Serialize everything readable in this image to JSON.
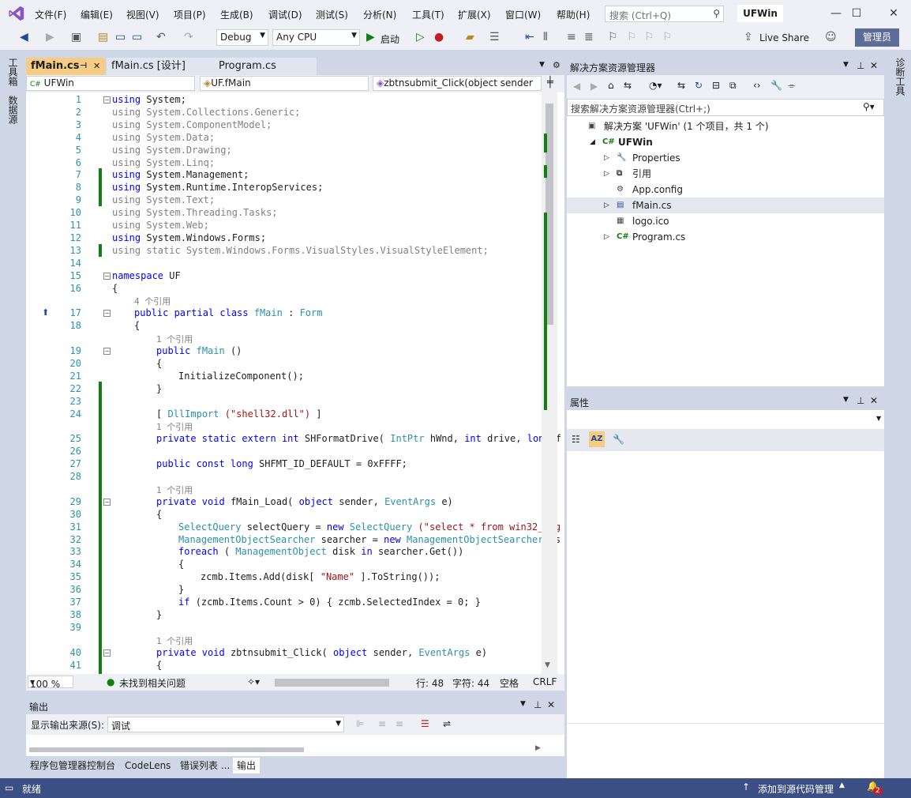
{
  "app": {
    "title": "UFWin",
    "window_controls": [
      "minimize-icon",
      "maximize-icon",
      "close-icon"
    ]
  },
  "menu": {
    "items": [
      "文件(F)",
      "编辑(E)",
      "视图(V)",
      "项目(P)",
      "生成(B)",
      "调试(D)",
      "测试(S)",
      "分析(N)",
      "工具(T)",
      "扩展(X)",
      "窗口(W)",
      "帮助(H)"
    ],
    "search_placeholder": "搜索 (Ctrl+Q)",
    "solution_name": "UFWin"
  },
  "toolbar": {
    "config": "Debug",
    "platform": "Any CPU",
    "start_label": "启动",
    "live_share": "Live Share",
    "admin": "管理员"
  },
  "left_sidebar": {
    "items": [
      "工具箱",
      "数据源"
    ]
  },
  "right_sidebar": {
    "items": [
      "诊断工具"
    ]
  },
  "editor": {
    "tabs": [
      {
        "label": "fMain.cs",
        "active": true
      },
      {
        "label": "fMain.cs [设计]",
        "active": false
      },
      {
        "label": "Program.cs",
        "active": false
      }
    ],
    "nav": {
      "project": "UFWin",
      "class": "UF.fMain",
      "member": "zbtnsubmit_Click(object sender"
    },
    "lines": [
      {
        "n": "1",
        "t": [
          [
            "kw",
            "using"
          ],
          [
            "",
            "System;"
          ]
        ]
      },
      {
        "n": "2",
        "t": [
          [
            "gr",
            "using System.Collections.Generic;"
          ]
        ]
      },
      {
        "n": "3",
        "t": [
          [
            "gr",
            "using System.ComponentModel;"
          ]
        ]
      },
      {
        "n": "4",
        "t": [
          [
            "gr",
            "using System.Data;"
          ]
        ]
      },
      {
        "n": "5",
        "t": [
          [
            "gr",
            "using System.Drawing;"
          ]
        ]
      },
      {
        "n": "6",
        "t": [
          [
            "gr",
            "using System.Linq;"
          ]
        ]
      },
      {
        "n": "7",
        "t": [
          [
            "kw",
            "using"
          ],
          [
            "",
            "System.Management;"
          ]
        ]
      },
      {
        "n": "8",
        "t": [
          [
            "kw",
            "using"
          ],
          [
            "",
            "System.Runtime.InteropServices;"
          ]
        ]
      },
      {
        "n": "9",
        "t": [
          [
            "gr",
            "using System.Text;"
          ]
        ]
      },
      {
        "n": "10",
        "t": [
          [
            "gr",
            "using System.Threading.Tasks;"
          ]
        ]
      },
      {
        "n": "11",
        "t": [
          [
            "gr",
            "using System.Web;"
          ]
        ]
      },
      {
        "n": "12",
        "t": [
          [
            "kw",
            "using"
          ],
          [
            "",
            "System.Windows.Forms;"
          ]
        ]
      },
      {
        "n": "13",
        "t": [
          [
            "gr",
            "using static System.Windows.Forms.VisualStyles.VisualStyleElement;"
          ]
        ]
      },
      {
        "n": "14",
        "t": []
      },
      {
        "n": "15",
        "t": [
          [
            "kw",
            "namespace"
          ],
          [
            "",
            "UF"
          ]
        ]
      },
      {
        "n": "16",
        "t": [
          [
            "",
            "{"
          ]
        ]
      },
      {
        "n": "",
        "ref": "4 个引用",
        "ind": 4
      },
      {
        "n": "17",
        "t": [
          [
            "kw",
            "public partial class"
          ],
          [
            "ty",
            "fMain"
          ],
          [
            "",
            ":"
          ],
          [
            "ty",
            "Form"
          ]
        ],
        "ind": 4
      },
      {
        "n": "18",
        "t": [
          [
            "",
            "{"
          ]
        ],
        "ind": 4
      },
      {
        "n": "",
        "ref": "1 个引用",
        "ind": 8
      },
      {
        "n": "19",
        "t": [
          [
            "kw",
            "public"
          ],
          [
            "ty",
            "fMain"
          ],
          [
            "",
            "()"
          ]
        ],
        "ind": 8
      },
      {
        "n": "20",
        "t": [
          [
            "",
            "{"
          ]
        ],
        "ind": 8
      },
      {
        "n": "21",
        "t": [
          [
            "",
            "InitializeComponent();"
          ]
        ],
        "ind": 12
      },
      {
        "n": "22",
        "t": [
          [
            "",
            "}"
          ]
        ],
        "ind": 8
      },
      {
        "n": "23",
        "t": []
      },
      {
        "n": "24",
        "t": [
          [
            "",
            "["
          ],
          [
            "ty",
            "DllImport"
          ],
          [
            "st",
            "(\"shell32.dll\")"
          ],
          [
            "",
            "]"
          ]
        ],
        "ind": 8
      },
      {
        "n": "",
        "ref": "1 个引用",
        "ind": 8
      },
      {
        "n": "25",
        "t": [
          [
            "kw",
            "private static extern int"
          ],
          [
            "",
            "SHFormatDrive("
          ],
          [
            "ty",
            "IntPtr"
          ],
          [
            "",
            "hWnd,"
          ],
          [
            "kw",
            "int"
          ],
          [
            "",
            "drive,"
          ],
          [
            "kw",
            "long"
          ],
          [
            "",
            "f"
          ]
        ],
        "ind": 8
      },
      {
        "n": "26",
        "t": []
      },
      {
        "n": "27",
        "t": [
          [
            "kw",
            "public const long"
          ],
          [
            "",
            "SHFMT_ID_DEFAULT = 0xFFFF;"
          ]
        ],
        "ind": 8
      },
      {
        "n": "28",
        "t": []
      },
      {
        "n": "",
        "ref": "1 个引用",
        "ind": 8
      },
      {
        "n": "29",
        "t": [
          [
            "kw",
            "private void"
          ],
          [
            "",
            "fMain_Load("
          ],
          [
            "kw",
            "object"
          ],
          [
            "",
            "sender,"
          ],
          [
            "ty",
            "EventArgs"
          ],
          [
            "",
            "e)"
          ]
        ],
        "ind": 8
      },
      {
        "n": "30",
        "t": [
          [
            "",
            "{"
          ]
        ],
        "ind": 8
      },
      {
        "n": "31",
        "t": [
          [
            "ty",
            "SelectQuery"
          ],
          [
            "",
            "selectQuery ="
          ],
          [
            "kw",
            "new"
          ],
          [
            "ty",
            "SelectQuery"
          ],
          [
            "st",
            "(\"select * from win32_log"
          ]
        ],
        "ind": 12
      },
      {
        "n": "32",
        "t": [
          [
            "ty",
            "ManagementObjectSearcher"
          ],
          [
            "",
            "searcher ="
          ],
          [
            "kw",
            "new"
          ],
          [
            "ty",
            "ManagementObjectSearcher"
          ],
          [
            "",
            "(s"
          ]
        ],
        "ind": 12
      },
      {
        "n": "33",
        "t": [
          [
            "kw",
            "foreach"
          ],
          [
            "",
            "("
          ],
          [
            "ty",
            "ManagementObject"
          ],
          [
            "",
            "disk"
          ],
          [
            "kw",
            "in"
          ],
          [
            "",
            "searcher.Get())"
          ]
        ],
        "ind": 12
      },
      {
        "n": "34",
        "t": [
          [
            "",
            "{"
          ]
        ],
        "ind": 12
      },
      {
        "n": "35",
        "t": [
          [
            "",
            "zcmb.Items.Add(disk["
          ],
          [
            "st",
            "\"Name\""
          ],
          [
            "",
            "].ToString());"
          ]
        ],
        "ind": 16
      },
      {
        "n": "36",
        "t": [
          [
            "",
            "}"
          ]
        ],
        "ind": 12
      },
      {
        "n": "37",
        "t": [
          [
            "kw",
            "if"
          ],
          [
            "",
            "(zcmb.Items.Count > 0) { zcmb.SelectedIndex = 0; }"
          ]
        ],
        "ind": 12
      },
      {
        "n": "38",
        "t": [
          [
            "",
            "}"
          ]
        ],
        "ind": 8
      },
      {
        "n": "39",
        "t": []
      },
      {
        "n": "",
        "ref": "1 个引用",
        "ind": 8
      },
      {
        "n": "40",
        "t": [
          [
            "kw",
            "private void"
          ],
          [
            "",
            "zbtnsubmit_Click("
          ],
          [
            "kw",
            "object"
          ],
          [
            "",
            "sender,"
          ],
          [
            "ty",
            "EventArgs"
          ],
          [
            "",
            "e)"
          ]
        ],
        "ind": 8
      },
      {
        "n": "41",
        "t": [
          [
            "",
            "{"
          ]
        ],
        "ind": 8
      }
    ],
    "status": {
      "zoom": "100 %",
      "issues": "未找到相关问题",
      "line": "行: 48",
      "char": "字符: 44",
      "mode": "空格",
      "eol": "CRLF"
    }
  },
  "output": {
    "title": "输出",
    "source_label": "显示输出来源(S):",
    "source_value": "调试",
    "tabs": [
      {
        "label": "程序包管理器控制台",
        "active": false
      },
      {
        "label": "CodeLens",
        "active": false
      },
      {
        "label": "错误列表 ...",
        "active": false
      },
      {
        "label": "输出",
        "active": true
      }
    ]
  },
  "solution_explorer": {
    "title": "解决方案资源管理器",
    "search_placeholder": "搜索解决方案资源管理器(Ctrl+;)",
    "tree": [
      {
        "label": "解决方案 'UFWin' (1 个项目，共 1 个)",
        "icon": "solution-icon",
        "level": 0,
        "expander": "",
        "bold": false
      },
      {
        "label": "UFWin",
        "icon": "csharp-project-icon",
        "level": 1,
        "expander": "◢",
        "bold": true
      },
      {
        "label": "Properties",
        "icon": "wrench-icon",
        "level": 2,
        "expander": "▷",
        "bold": false
      },
      {
        "label": "引用",
        "icon": "references-icon",
        "level": 2,
        "expander": "▷",
        "bold": false
      },
      {
        "label": "App.config",
        "icon": "config-icon",
        "level": 2,
        "expander": "",
        "bold": false
      },
      {
        "label": "fMain.cs",
        "icon": "form-icon",
        "level": 2,
        "expander": "▷",
        "bold": false,
        "selected": true
      },
      {
        "label": "logo.ico",
        "icon": "ico-file-icon",
        "level": 2,
        "expander": "",
        "bold": false
      },
      {
        "label": "Program.cs",
        "icon": "csharp-file-icon",
        "level": 2,
        "expander": "▷",
        "bold": false
      }
    ]
  },
  "properties": {
    "title": "属性"
  },
  "statusbar": {
    "ready": "就绪",
    "source_control": "添加到源代码管理",
    "notifications": "2"
  }
}
